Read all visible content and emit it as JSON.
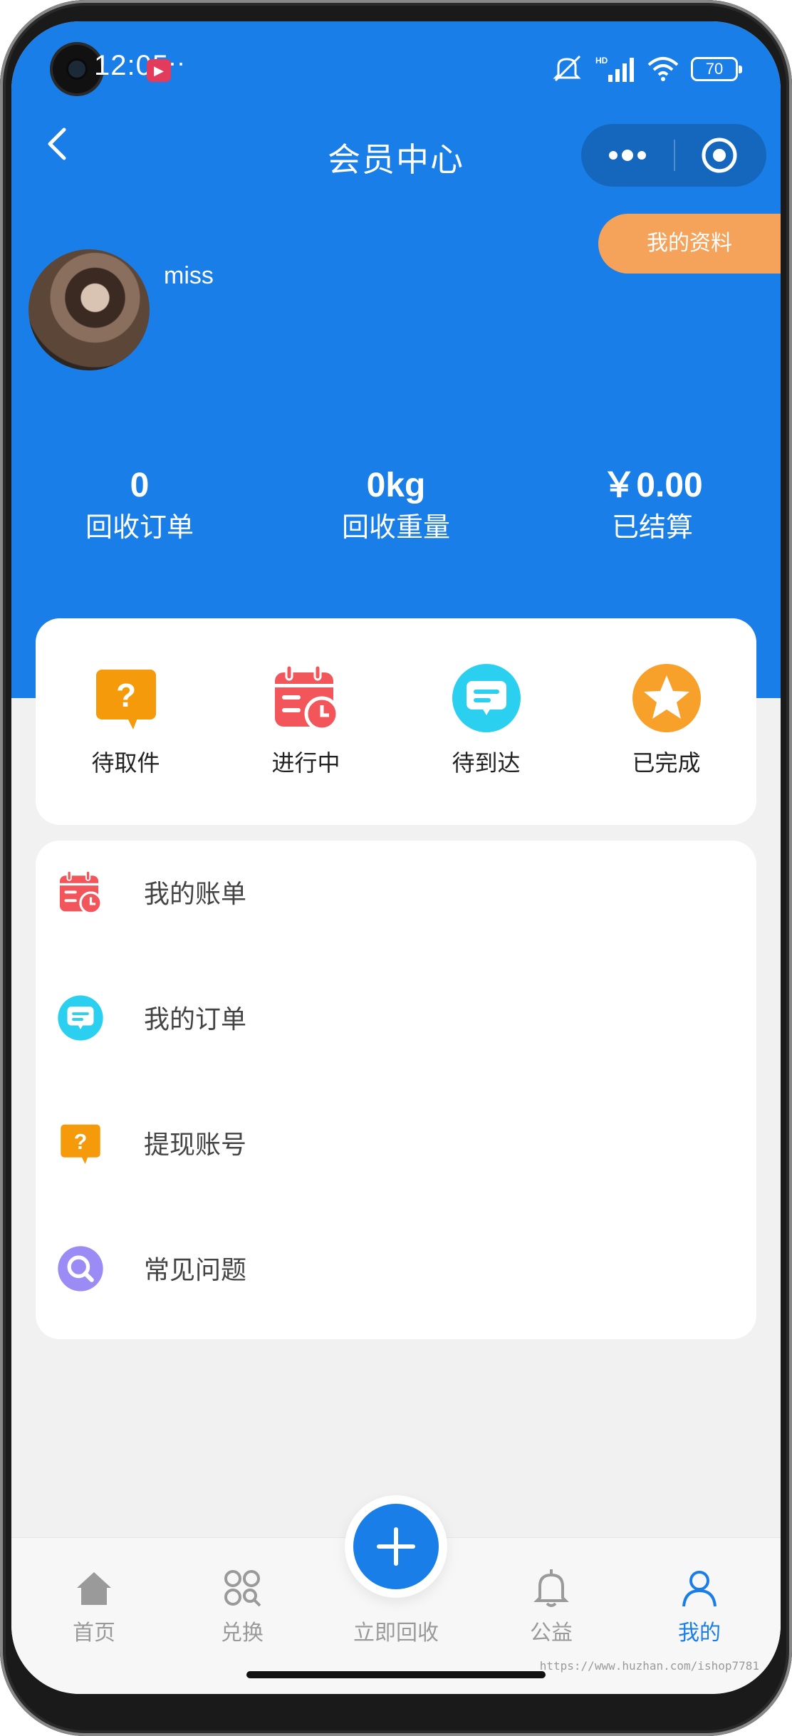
{
  "status_bar": {
    "time": "12:05",
    "dots": "··",
    "network": "HD",
    "battery": "70"
  },
  "nav": {
    "title": "会员中心"
  },
  "profile": {
    "username": "miss",
    "profile_button": "我的资料"
  },
  "stats": [
    {
      "value": "0",
      "label": "回收订单"
    },
    {
      "value": "0kg",
      "label": "回收重量"
    },
    {
      "value": "￥0.00",
      "label": "已结算"
    }
  ],
  "order_status": [
    {
      "label": "待取件",
      "icon": "question-bubble-icon",
      "color": "#f59a0a"
    },
    {
      "label": "进行中",
      "icon": "calendar-clock-icon",
      "color": "#f2555a"
    },
    {
      "label": "待到达",
      "icon": "message-bubble-icon",
      "color": "#2bd0f0"
    },
    {
      "label": "已完成",
      "icon": "star-icon",
      "color": "#f7a12a"
    }
  ],
  "menu": [
    {
      "label": "我的账单",
      "icon": "calendar-clock-icon"
    },
    {
      "label": "我的订单",
      "icon": "message-bubble-icon"
    },
    {
      "label": "提现账号",
      "icon": "question-bubble-icon"
    },
    {
      "label": "常见问题",
      "icon": "search-circle-icon"
    }
  ],
  "tabs": [
    {
      "label": "首页",
      "icon": "home-icon",
      "active": false
    },
    {
      "label": "兑换",
      "icon": "grid-icon",
      "active": false
    },
    {
      "label": "立即回收",
      "icon": "plus-icon",
      "active": false
    },
    {
      "label": "公益",
      "icon": "bell-icon",
      "active": false
    },
    {
      "label": "我的",
      "icon": "user-icon",
      "active": true
    }
  ],
  "watermark": "https://www.huzhan.com/ishop7781",
  "colors": {
    "primary": "#1a7ee8",
    "accent_orange": "#f5a35b",
    "background": "#f1f1f1"
  }
}
